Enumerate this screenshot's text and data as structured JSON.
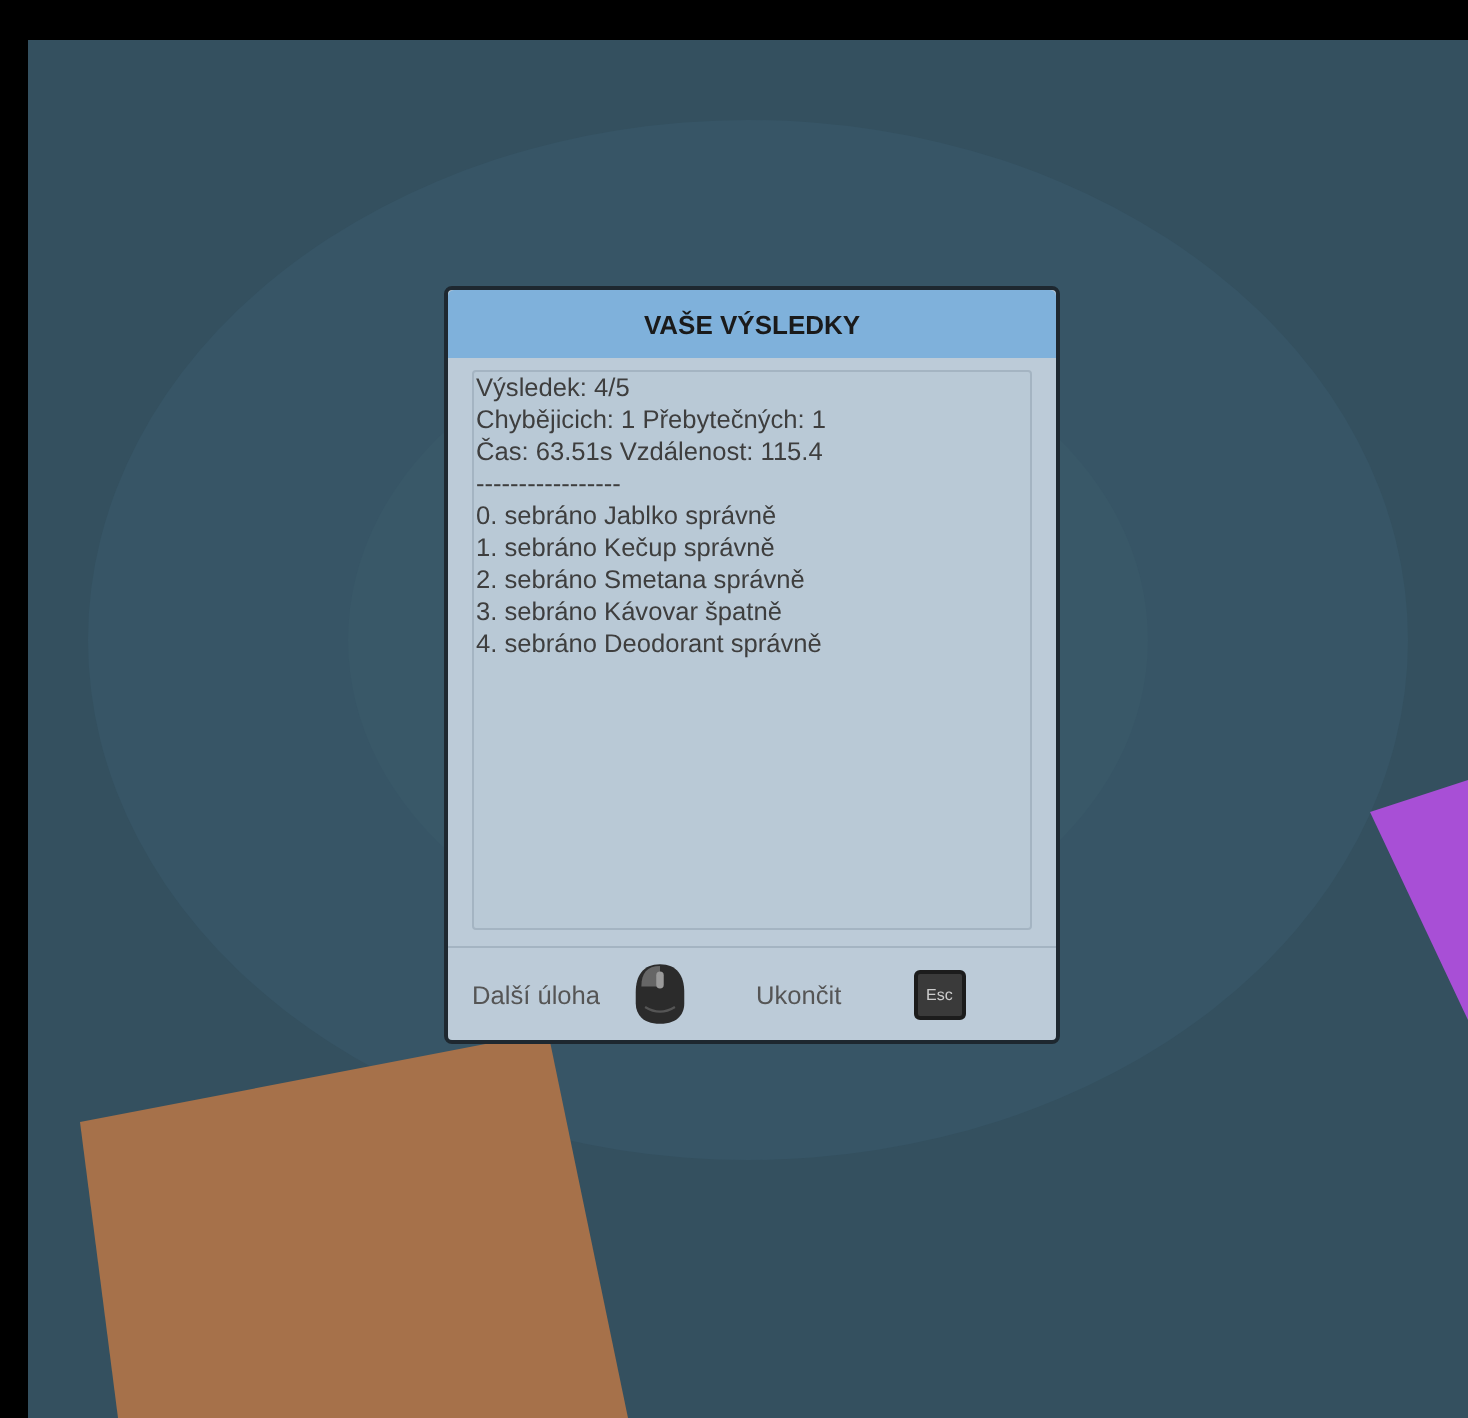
{
  "dialog": {
    "title": "VAŠE VÝSLEDKY",
    "lines": [
      "Výsledek: 4/5",
      "Chybějicich: 1 Přebytečných: 1",
      "Čas: 63.51s Vzdálenost: 115.4",
      "-----------------",
      "0. sebráno Jablko správně",
      "1. sebráno Kečup správně",
      "2. sebráno Smetana správně",
      "3. sebráno Kávovar špatně",
      "4. sebráno Deodorant správně"
    ],
    "footer": [
      {
        "kind": "label",
        "text": "Další úloha"
      },
      {
        "kind": "mouse"
      },
      {
        "kind": "label",
        "text": "Ukončit"
      },
      {
        "kind": "key",
        "text": "Esc"
      }
    ]
  }
}
